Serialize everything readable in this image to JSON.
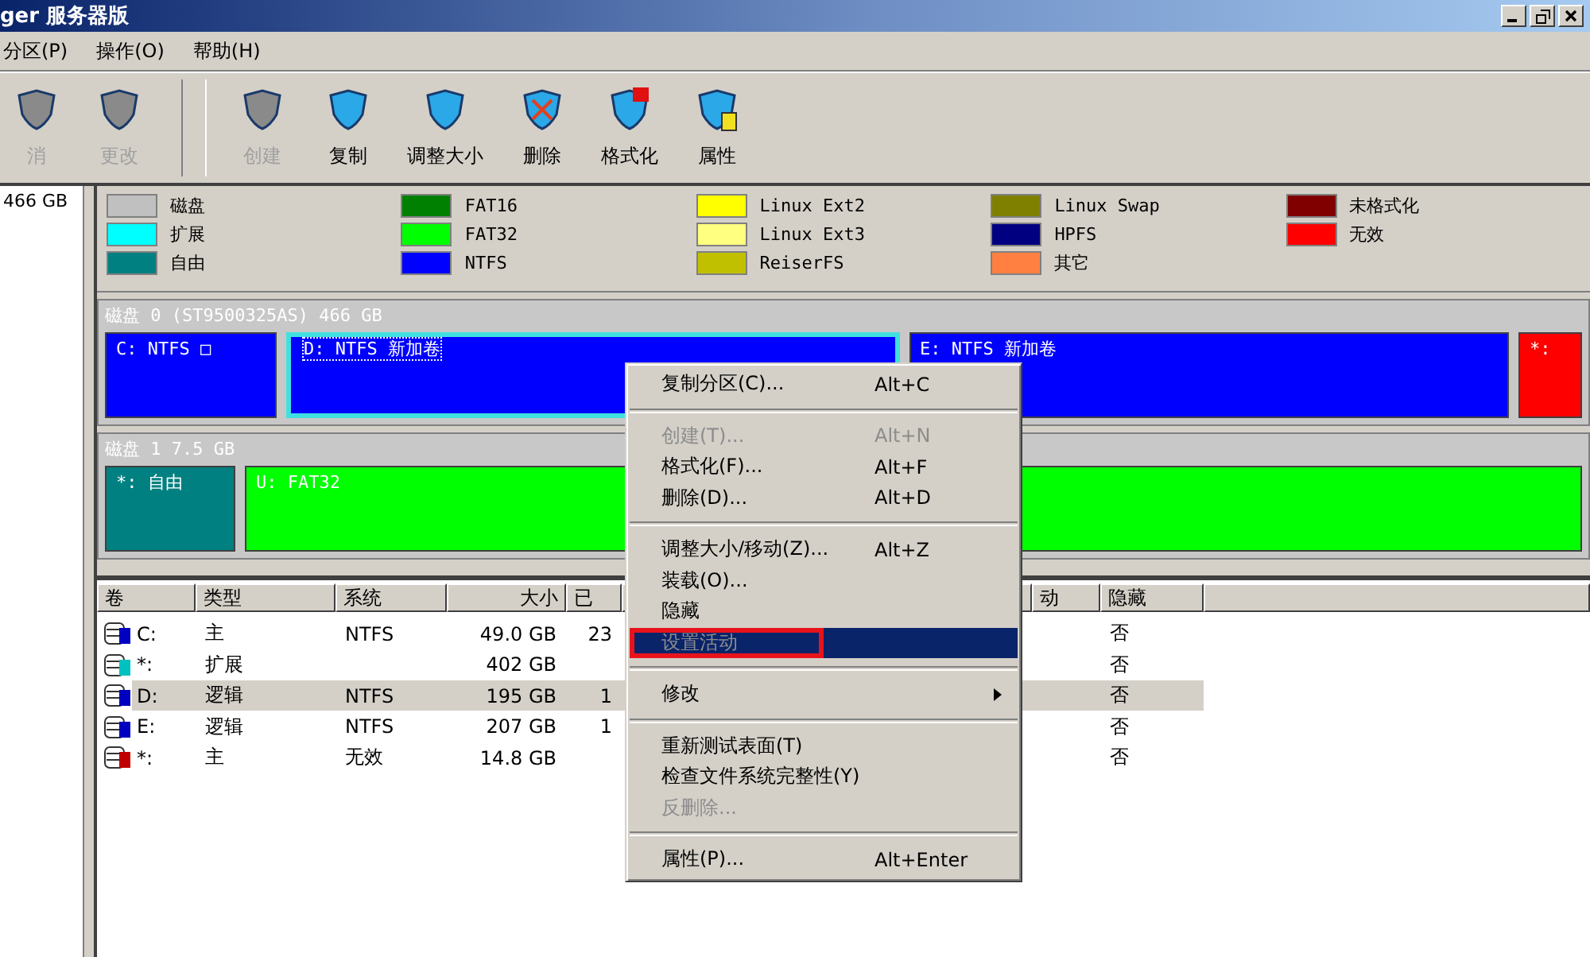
{
  "window": {
    "title": "ger 服务器版"
  },
  "menu_bar": [
    {
      "label": "分区(P)"
    },
    {
      "label": "操作(O)"
    },
    {
      "label": "帮助(H)"
    }
  ],
  "toolbar": {
    "groups": [
      {
        "buttons": [
          {
            "label": "消",
            "disabled": true
          },
          {
            "label": "更改",
            "disabled": true
          }
        ]
      },
      {
        "buttons": [
          {
            "label": "创建",
            "disabled": true
          },
          {
            "label": "复制",
            "disabled": false
          },
          {
            "label": "调整大小",
            "disabled": false
          },
          {
            "label": "删除",
            "disabled": false
          },
          {
            "label": "格式化",
            "disabled": false
          },
          {
            "label": "属性",
            "disabled": false
          }
        ]
      }
    ]
  },
  "sidebar": {
    "items": [
      {
        "label": "466 GB"
      }
    ]
  },
  "legend": [
    {
      "label": "磁盘",
      "color": "#c0c0c0"
    },
    {
      "label": "扩展",
      "color": "#00ffff"
    },
    {
      "label": "自由",
      "color": "#008080"
    },
    {
      "label": "FAT16",
      "color": "#008000"
    },
    {
      "label": "FAT32",
      "color": "#00ff00"
    },
    {
      "label": "NTFS",
      "color": "#0000ff"
    },
    {
      "label": "Linux Ext2",
      "color": "#ffff00"
    },
    {
      "label": "Linux Ext3",
      "color": "#ffff80"
    },
    {
      "label": "ReiserFS",
      "color": "#c0c000"
    },
    {
      "label": "Linux Swap",
      "color": "#808000"
    },
    {
      "label": "HPFS",
      "color": "#000080"
    },
    {
      "label": "其它",
      "color": "#ff8040"
    },
    {
      "label": "未格式化",
      "color": "#800000"
    },
    {
      "label": "无效",
      "color": "#ff0000"
    }
  ],
  "disks": [
    {
      "title": "磁盘 0 (ST9500325AS) 466 GB",
      "partitions": [
        {
          "label": "C: NTFS □",
          "color": "#0000ff",
          "selected": false,
          "kind": "fixed"
        },
        {
          "label": "D: NTFS 新加卷",
          "color": "#0000ff",
          "selected": true,
          "kind": "grow"
        },
        {
          "label": "E: NTFS 新加卷",
          "color": "#0000ff",
          "selected": false,
          "kind": "grow"
        },
        {
          "label": "*:",
          "color": "#ff0000",
          "selected": false,
          "kind": "narrow"
        }
      ]
    },
    {
      "title": "磁盘 1 7.5 GB",
      "partitions": [
        {
          "label": "*: 自由",
          "color": "#008080",
          "selected": false,
          "kind": "small"
        },
        {
          "label": "U: FAT32",
          "color": "#00ff00",
          "selected": false,
          "kind": "grow"
        }
      ]
    }
  ],
  "table": {
    "columns": [
      {
        "label": "卷"
      },
      {
        "label": "类型"
      },
      {
        "label": "系统"
      },
      {
        "label": "大小"
      },
      {
        "label": "已"
      },
      {
        "label": "动"
      },
      {
        "label": "隐藏"
      }
    ],
    "rows": [
      {
        "volume": "C:",
        "type": "主",
        "system": "NTFS",
        "size": "49.0 GB",
        "column_5": "23",
        "hidden": "否",
        "color": "#0000c0",
        "selected": false
      },
      {
        "volume": "*:",
        "type": "扩展",
        "size": "402 GB",
        "hidden": "否",
        "color": "#00c0c0",
        "selected": false
      },
      {
        "volume": "D:",
        "type": "逻辑",
        "system": "NTFS",
        "size": "195 GB",
        "column_5": "1",
        "hidden": "否",
        "color": "#0000c0",
        "selected": true
      },
      {
        "volume": "E:",
        "type": "逻辑",
        "system": "NTFS",
        "size": "207 GB",
        "column_5": "1",
        "hidden": "否",
        "color": "#0000c0",
        "selected": false
      },
      {
        "volume": "*:",
        "type": "主",
        "system": "无效",
        "size": "14.8 GB",
        "hidden": "否",
        "color": "#c00000",
        "selected": false
      }
    ]
  },
  "context_menu": [
    {
      "kind": "item",
      "label": "复制分区(C)...",
      "shortcut": "Alt+C",
      "disabled": false,
      "selected": false
    },
    {
      "kind": "separator"
    },
    {
      "kind": "item",
      "label": "创建(T)...",
      "shortcut": "Alt+N",
      "disabled": true,
      "selected": false
    },
    {
      "kind": "item",
      "label": "格式化(F)...",
      "shortcut": "Alt+F",
      "disabled": false,
      "selected": false
    },
    {
      "kind": "item",
      "label": "删除(D)...",
      "shortcut": "Alt+D",
      "disabled": false,
      "selected": false
    },
    {
      "kind": "separator"
    },
    {
      "kind": "item",
      "label": "调整大小/移动(Z)...",
      "shortcut": "Alt+Z",
      "disabled": false,
      "selected": false
    },
    {
      "kind": "item",
      "label": "装载(O)...",
      "disabled": false,
      "selected": false
    },
    {
      "kind": "item",
      "label": "隐藏",
      "disabled": false,
      "selected": false
    },
    {
      "kind": "item",
      "label": "设置活动",
      "disabled": true,
      "selected": true,
      "annotated": true
    },
    {
      "kind": "separator"
    },
    {
      "kind": "submenu",
      "label": "修改",
      "disabled": false,
      "selected": false
    },
    {
      "kind": "separator"
    },
    {
      "kind": "item",
      "label": "重新测试表面(T)",
      "disabled": false,
      "selected": false
    },
    {
      "kind": "item",
      "label": "检查文件系统完整性(Y)",
      "disabled": false,
      "selected": false
    },
    {
      "kind": "item",
      "label": "反删除...",
      "disabled": true,
      "selected": false
    },
    {
      "kind": "separator"
    },
    {
      "kind": "item",
      "label": "属性(P)...",
      "shortcut": "Alt+Enter",
      "disabled": false,
      "selected": false
    }
  ]
}
